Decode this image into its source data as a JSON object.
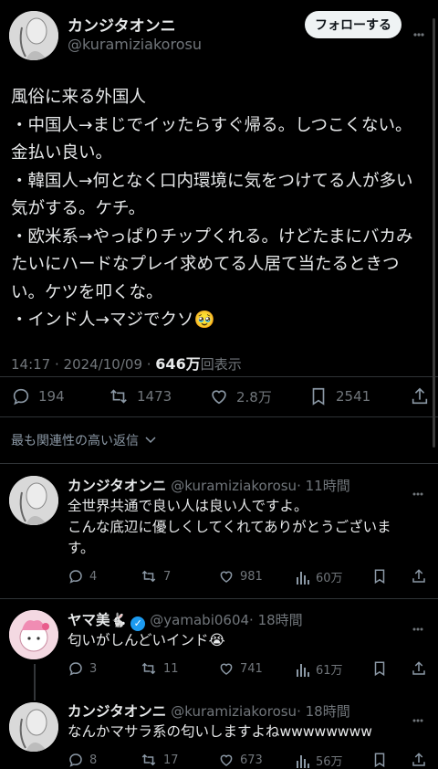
{
  "post": {
    "author_name": "カンジタオンニ",
    "author_handle": "@kuramiziakorosu",
    "follow_label": "フォローする",
    "lines": [
      "風俗に来る外国人",
      "・中国人→まじでイッたらすぐ帰る。しつこくない。",
      "金払い良い。",
      "・韓国人→何となく口内環境に気をつけてる人が多い",
      "気がする。ケチ。",
      "・欧米系→やっぱりチップくれる。けどたまにバカみ",
      "たいにハードなプレイ求めてる人居て当たるときつ",
      "い。ケツを叩くな。",
      "・インド人→マジでクソ🥹"
    ],
    "time": "14:17 · 2024/10/09 · ",
    "views": "646万",
    "views_suffix": "回表示",
    "replies": "194",
    "retweets": "1473",
    "likes": "2.8万",
    "bookmarks": "2541"
  },
  "sort_label": "最も関連性の高い返信",
  "replies": [
    {
      "name": "カンジタオンニ",
      "handle": "@kuramiziakorosu",
      "time": "· 11時間",
      "lines": [
        "全世界共通で良い人は良い人ですよ。",
        "こんな底辺に優しくしてくれてありがとうございま",
        "す。"
      ],
      "replies": "4",
      "retweets": "7",
      "likes": "981",
      "views": "60万"
    },
    {
      "name": "ヤマ美",
      "name_emoji": "🐇",
      "handle": "@yamabi0604",
      "time": "· 18時間",
      "lines": [
        "匂いがしんどいインド😭"
      ],
      "replies": "3",
      "retweets": "11",
      "likes": "741",
      "views": "61万"
    },
    {
      "name": "カンジタオンニ",
      "handle": "@kuramiziakorosu",
      "time": "· 18時間",
      "lines": [
        "なんかマサラ系の匂いしますよねwwwwwwww"
      ],
      "replies": "8",
      "retweets": "17",
      "likes": "673",
      "views": "56万"
    }
  ],
  "colors": {
    "background": "#000000",
    "text": "#e7e9ea",
    "muted": "#71767b",
    "verified": "#1d9bf0"
  }
}
